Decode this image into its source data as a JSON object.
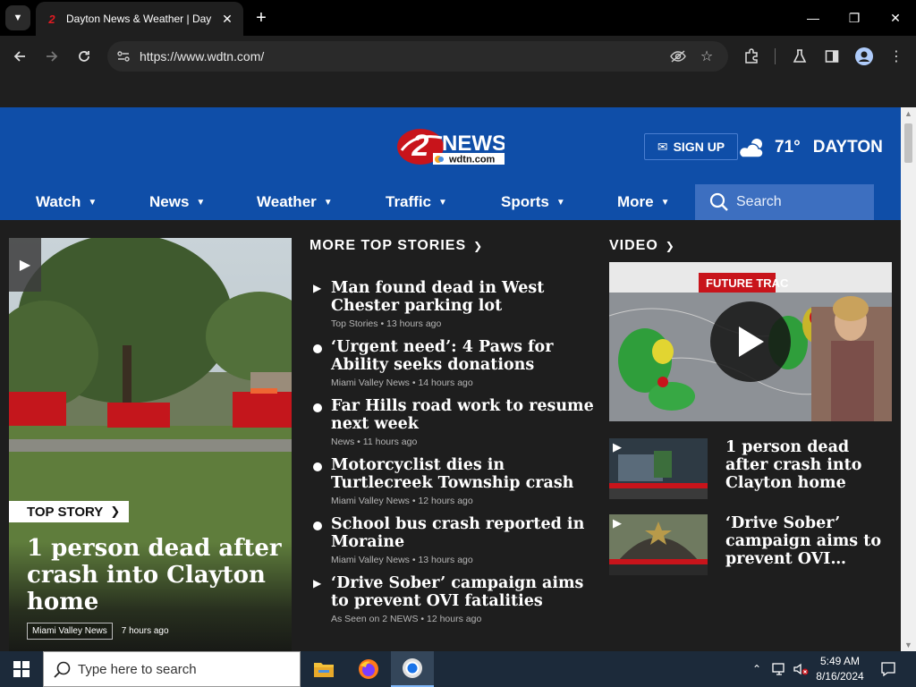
{
  "browser": {
    "tab_title": "Dayton News & Weather | Day",
    "url": "https://www.wdtn.com/",
    "tab_menu_icon": "chevron-down-icon",
    "new_tab_label": "+"
  },
  "site": {
    "logo_number": "2",
    "logo_news": "NEWS",
    "logo_domain": "wdtn.com",
    "signup_label": "SIGN UP",
    "weather_temp": "71°",
    "weather_city": "DAYTON",
    "nav": [
      "Watch",
      "News",
      "Weather",
      "Traffic",
      "Sports",
      "More"
    ],
    "search_placeholder": "Search",
    "colors": {
      "header": "#0f4ea8",
      "page_bg": "#1e1e1e",
      "search_bg": "#3d6fc0"
    }
  },
  "hero": {
    "tag": "TOP STORY",
    "headline": "1 person dead after crash into Clayton home",
    "source": "Miami Valley News",
    "time": "7 hours ago"
  },
  "more_top_stories": {
    "title": "MORE TOP STORIES",
    "items": [
      {
        "title": "Man found dead in West Chester parking lot",
        "source": "Top Stories",
        "time": "13 hours ago",
        "type": "video"
      },
      {
        "title": "‘Urgent need’: 4 Paws for Ability seeks donations",
        "source": "Miami Valley News",
        "time": "14 hours ago",
        "type": "article"
      },
      {
        "title": "Far Hills road work to resume next week",
        "source": "News",
        "time": "11 hours ago",
        "type": "article"
      },
      {
        "title": "Motorcyclist dies in Turtlecreek Township crash",
        "source": "Miami Valley News",
        "time": "12 hours ago",
        "type": "article"
      },
      {
        "title": "School bus crash reported in Moraine",
        "source": "Miami Valley News",
        "time": "13 hours ago",
        "type": "article"
      },
      {
        "title": "‘Drive Sober’ campaign aims to prevent OVI fatalities",
        "source": "As Seen on 2 NEWS",
        "time": "12 hours ago",
        "type": "video"
      }
    ]
  },
  "video": {
    "title": "VIDEO",
    "main_caption": "FUTURE TRAC",
    "items": [
      {
        "title": "1 person dead after crash into Clayton home"
      },
      {
        "title": "‘Drive Sober’ campaign aims to prevent OVI…"
      }
    ]
  },
  "taskbar": {
    "search_placeholder": "Type here to search",
    "time": "5:49 AM",
    "date": "8/16/2024"
  }
}
